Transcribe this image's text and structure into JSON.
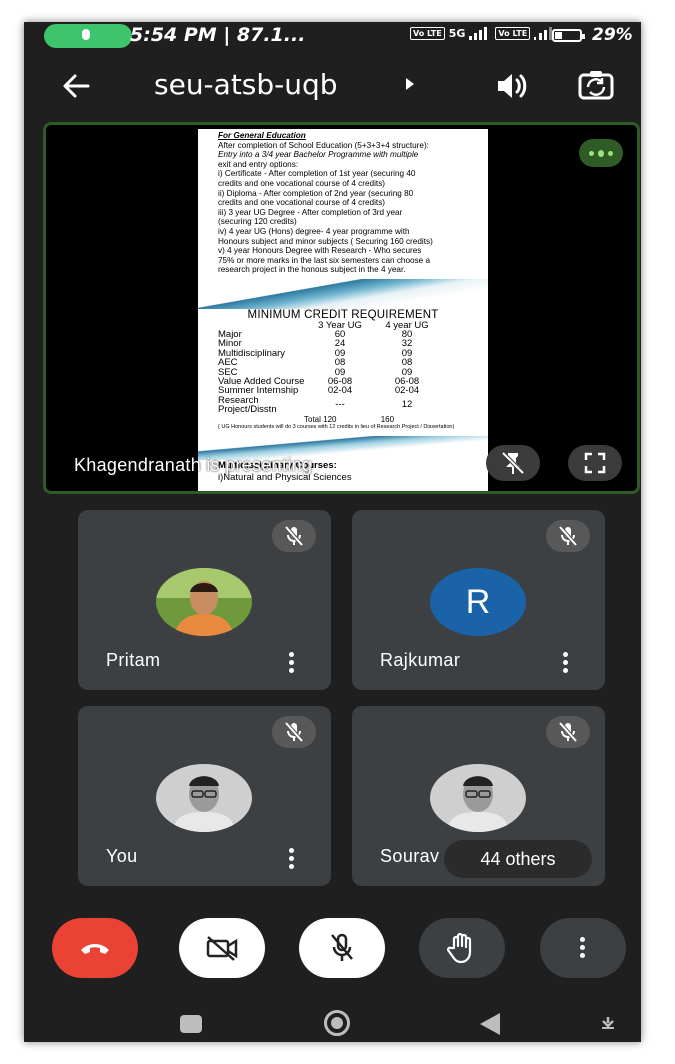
{
  "status_bar": {
    "time": "5:54 PM | 87.1...",
    "volte1": "Vo LTE",
    "network": "5G",
    "volte2": "Vo LTE",
    "battery_percent": "29%",
    "battery_level": 0.29
  },
  "header": {
    "meeting_code": "seu-atsb-uqb"
  },
  "presentation": {
    "presenter_text": "Khagendranath is presenting",
    "doc": {
      "heading": "For General Education",
      "intro_lines": [
        "After completion of School Education (5+3+3+4 structure):",
        "Entry into a 3/4 year Bachelor Programme with multiple",
        "exit  and entry  options:",
        "i) Certificate - After completion of 1st year (securing 40",
        "credits and one vocational course of 4 credits)",
        "ii) Diploma -  After completion of 2nd year (securing 80",
        "credits and one vocational course of 4 credits)",
        "iii) 3 year UG Degree - After completion of 3rd year",
        "(securing 120 credits)",
        "iv) 4 year UG (Hons) degree- 4 year programme with",
        "Honours subject and minor subjects ( Securing 160 credits)",
        "v) 4 year Honours Degree with Research - Who secures",
        "75% or more marks in the last six semesters can choose a",
        "research project in the honous subject in the 4 year."
      ],
      "credit_title": "MINIMUM CREDIT REQUIREMENT",
      "credit_header": [
        "",
        "3 Year UG",
        "4 year UG"
      ],
      "credit_rows": [
        [
          "Major",
          "60",
          "80"
        ],
        [
          "Minor",
          "24",
          "32"
        ],
        [
          "Multidisciplinary",
          "09",
          "09"
        ],
        [
          "AEC",
          "08",
          "08"
        ],
        [
          "SEC",
          "09",
          "09"
        ],
        [
          "Value Added Course",
          "06-08",
          "06-08"
        ],
        [
          "Summer Internship",
          "02-04",
          "02-04"
        ],
        [
          "Research Project/Disstn",
          "---",
          "12"
        ]
      ],
      "credit_total": [
        "Total",
        "120",
        "160"
      ],
      "credit_note": "( UG Honours students will do 3 courses with 12 credits in lieu of Research Project / Dissertation)",
      "multidisciplinary_title": "Multidisciplinary Courses:",
      "multidisciplinary_item": "i)Natural and Physical Sciences"
    }
  },
  "participants": [
    {
      "name": "Pritam",
      "avatar_type": "photo"
    },
    {
      "name": "Rajkumar",
      "avatar_letter": "R",
      "avatar_color": "#1b63a8"
    },
    {
      "name": "You",
      "avatar_type": "photo"
    },
    {
      "name": "Sourav",
      "avatar_type": "photo"
    }
  ],
  "others_count_label": "44 others",
  "colors": {
    "background": "#1f1f1f",
    "tile": "#3c4043",
    "end_call": "#ea4335",
    "active_speaker_border": "#2f5c25"
  },
  "icons": {
    "back": "arrow-left-icon",
    "speaker": "speaker-icon",
    "switch_camera": "switch-camera-icon",
    "pin_off": "pin-off-icon",
    "fullscreen": "fullscreen-icon",
    "mic_off": "mic-off-icon",
    "end_call": "end-call-icon",
    "camera_off": "camera-off-icon",
    "raise_hand": "raise-hand-icon",
    "more": "more-vert-icon"
  }
}
